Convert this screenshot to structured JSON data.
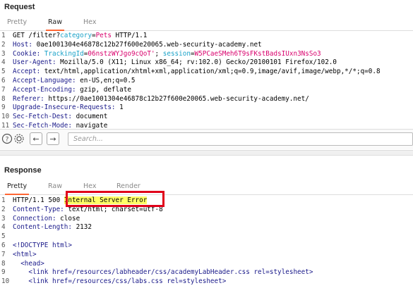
{
  "request": {
    "title": "Request",
    "tabs": [
      "Pretty",
      "Raw",
      "Hex"
    ],
    "active_tab": "Raw",
    "lines": [
      {
        "n": "1",
        "parts": [
          [
            "",
            "GET /filter?"
          ],
          [
            "param",
            "category"
          ],
          [
            "",
            "="
          ],
          [
            "pval",
            "Pets"
          ],
          [
            "",
            " HTTP/1.1"
          ]
        ]
      },
      {
        "n": "2",
        "parts": [
          [
            "key",
            "Host:"
          ],
          [
            "",
            " 0ae1001304e46878c12b27f600e20065.web-security-academy.net"
          ]
        ]
      },
      {
        "n": "3",
        "parts": [
          [
            "cookie-key",
            "Cookie:"
          ],
          [
            "",
            " "
          ],
          [
            "cookie-name",
            "TrackingId"
          ],
          [
            "",
            "="
          ],
          [
            "cookie-val",
            "06nstzWYJgo9cQoT'"
          ],
          [
            "",
            "; "
          ],
          [
            "cookie-name",
            "session"
          ],
          [
            "",
            "="
          ],
          [
            "cookie-val",
            "W5PCaeSMeh6T9sFKstBadsIUxn3NsSo3"
          ]
        ]
      },
      {
        "n": "4",
        "parts": [
          [
            "key",
            "User-Agent:"
          ],
          [
            "",
            " Mozilla/5.0 (X11; Linux x86_64; rv:102.0) Gecko/20100101 Firefox/102.0"
          ]
        ]
      },
      {
        "n": "5",
        "parts": [
          [
            "key",
            "Accept:"
          ],
          [
            "",
            " text/html,application/xhtml+xml,application/xml;q=0.9,image/avif,image/webp,*/*;q=0.8"
          ]
        ]
      },
      {
        "n": "6",
        "parts": [
          [
            "key",
            "Accept-Language:"
          ],
          [
            "",
            " en-US,en;q=0.5"
          ]
        ]
      },
      {
        "n": "7",
        "parts": [
          [
            "key",
            "Accept-Encoding:"
          ],
          [
            "",
            " gzip, deflate"
          ]
        ]
      },
      {
        "n": "8",
        "parts": [
          [
            "key",
            "Referer:"
          ],
          [
            "",
            " https://0ae1001304e46878c12b27f600e20065.web-security-academy.net/"
          ]
        ]
      },
      {
        "n": "9",
        "parts": [
          [
            "key",
            "Upgrade-Insecure-Requests:"
          ],
          [
            "",
            " 1"
          ]
        ]
      },
      {
        "n": "10",
        "parts": [
          [
            "key",
            "Sec-Fetch-Dest:"
          ],
          [
            "",
            " document"
          ]
        ]
      },
      {
        "n": "11",
        "parts": [
          [
            "key",
            "Sec-Fetch-Mode:"
          ],
          [
            "",
            " navigate"
          ]
        ]
      }
    ]
  },
  "toolbar": {
    "search_placeholder": "Search...",
    "icons": [
      "help-icon",
      "settings-icon",
      "back-arrow-icon",
      "forward-arrow-icon"
    ]
  },
  "response": {
    "title": "Response",
    "tabs": [
      "Pretty",
      "Raw",
      "Hex",
      "Render"
    ],
    "active_tab": "Pretty",
    "lines": [
      {
        "n": "1",
        "parts": [
          [
            "",
            "HTTP/1.1 500 "
          ],
          [
            "highlight",
            "Internal Server Error"
          ]
        ]
      },
      {
        "n": "2",
        "parts": [
          [
            "key",
            "Content-Type:"
          ],
          [
            "",
            " text/html; charset=utf-8"
          ]
        ]
      },
      {
        "n": "3",
        "parts": [
          [
            "key",
            "Connection:"
          ],
          [
            "",
            " close"
          ]
        ]
      },
      {
        "n": "4",
        "parts": [
          [
            "key",
            "Content-Length:"
          ],
          [
            "",
            " 2132"
          ]
        ]
      },
      {
        "n": "5",
        "parts": [
          [
            "",
            ""
          ]
        ]
      },
      {
        "n": "6",
        "parts": [
          [
            "tag",
            "<!DOCTYPE html>"
          ]
        ]
      },
      {
        "n": "7",
        "parts": [
          [
            "tag",
            "<html>"
          ]
        ]
      },
      {
        "n": "8",
        "parts": [
          [
            "",
            "  "
          ],
          [
            "tag",
            "<head>"
          ]
        ]
      },
      {
        "n": "9",
        "parts": [
          [
            "",
            "    "
          ],
          [
            "tag",
            "<link "
          ],
          [
            "attr",
            "href="
          ],
          [
            "attrv",
            "/resources/labheader/css/academyLabHeader.css"
          ],
          [
            "attr",
            " rel="
          ],
          [
            "attrv",
            "stylesheet"
          ],
          [
            "tag",
            ">"
          ]
        ]
      },
      {
        "n": "10",
        "parts": [
          [
            "",
            "    "
          ],
          [
            "tag",
            "<link "
          ],
          [
            "attr",
            "href="
          ],
          [
            "attrv",
            "/resources/css/labs.css"
          ],
          [
            "attr",
            " rel="
          ],
          [
            "attrv",
            "stylesheet"
          ],
          [
            "tag",
            ">"
          ]
        ]
      }
    ]
  },
  "colors": {
    "accent": "#ff6633",
    "highlight": "#ffff66",
    "annotation_box": "#e0001a"
  }
}
